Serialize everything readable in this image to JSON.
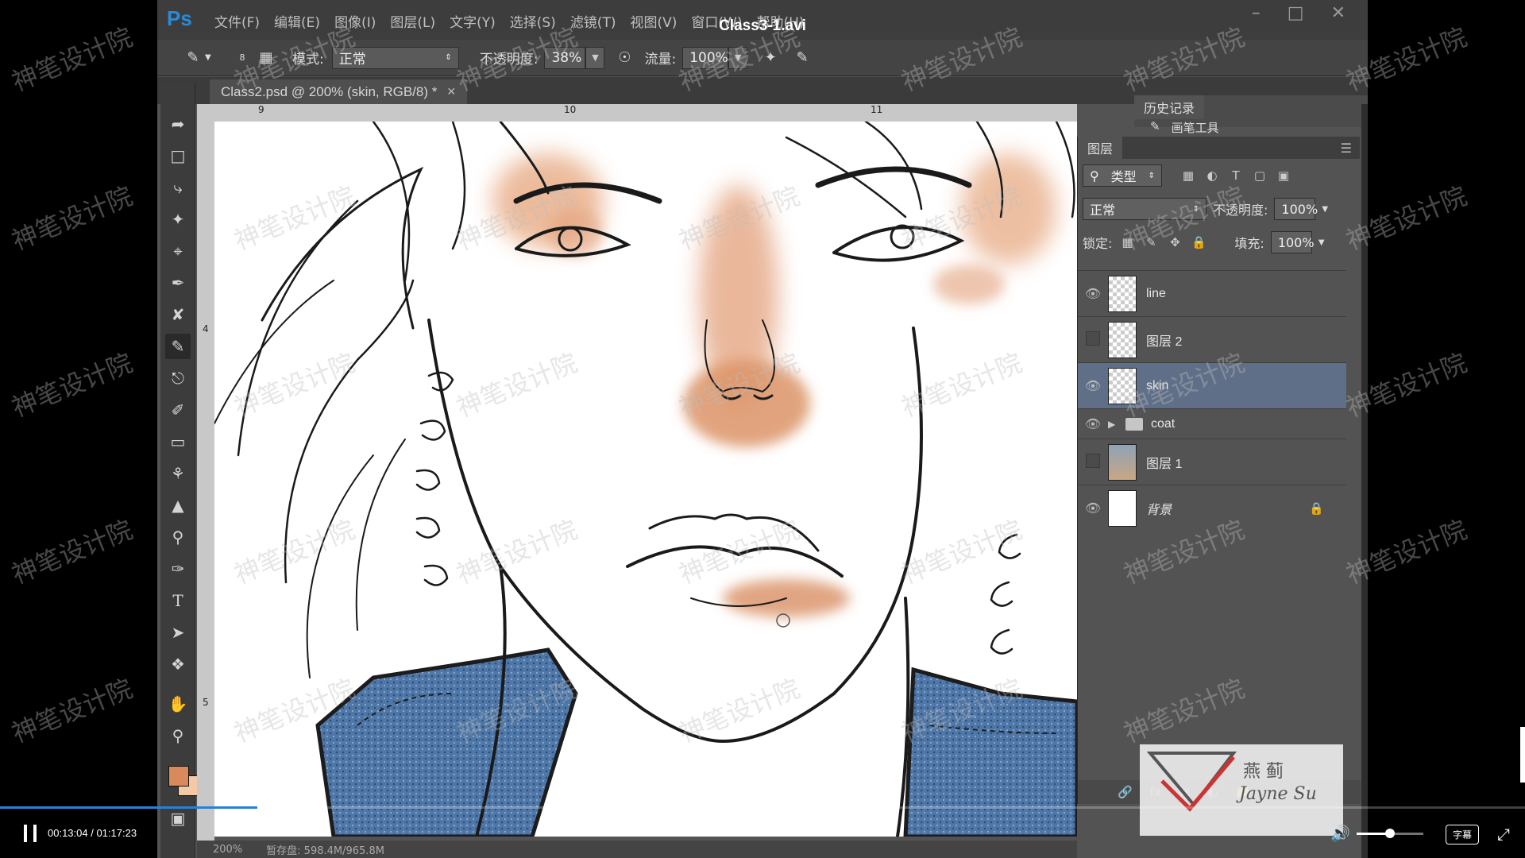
{
  "video": {
    "title": "Class3-1.avi",
    "time_display": "00:13:04 / 01:17:23",
    "progress": 0.169,
    "volume": 0.5,
    "subtitle_label": "字幕"
  },
  "ps": {
    "logo": "Ps",
    "menu": [
      "文件(F)",
      "编辑(E)",
      "图像(I)",
      "图层(L)",
      "文字(Y)",
      "选择(S)",
      "滤镜(T)",
      "视图(V)",
      "窗口(W)",
      "帮助(H)"
    ],
    "options": {
      "brush_size": "8",
      "mode_label": "模式:",
      "mode_value": "正常",
      "opacity_label": "不透明度:",
      "opacity_value": "38%",
      "flow_label": "流量:",
      "flow_value": "100%"
    },
    "doc_tab": "Class2.psd @ 200% (skin, RGB/8) *",
    "ruler_h": [
      "9",
      "10",
      "11"
    ],
    "ruler_v": [
      "4",
      "5"
    ],
    "status": {
      "zoom": "200%",
      "docsize": "暂存盘: 598.4M/965.8M"
    }
  },
  "history_panel": {
    "title": "历史记录",
    "item": "画笔工具"
  },
  "layers_panel": {
    "title": "图层",
    "filter_label": "类型",
    "blend_mode": "正常",
    "opacity_label": "不透明度:",
    "opacity_value": "100%",
    "lock_label": "锁定:",
    "fill_label": "填充:",
    "fill_value": "100%",
    "layers": [
      {
        "name": "line",
        "visible": true,
        "selected": false,
        "kind": "transparent"
      },
      {
        "name": "图层 2",
        "visible": false,
        "selected": false,
        "kind": "transparent"
      },
      {
        "name": "skin",
        "visible": true,
        "selected": true,
        "kind": "transparent"
      },
      {
        "name": "coat",
        "visible": true,
        "selected": false,
        "kind": "group"
      },
      {
        "name": "图层 1",
        "visible": false,
        "selected": false,
        "kind": "photo"
      },
      {
        "name": "背景",
        "visible": true,
        "selected": false,
        "kind": "background",
        "locked": true
      }
    ]
  },
  "watermark": "神笔设计院",
  "brand": {
    "signature": "Jayne Su",
    "glyphs": "燕 蓟"
  },
  "colors": {
    "foreground": "#d88a5c",
    "background": "#f3c9a8",
    "progress": "#2b7fd8",
    "selected_layer": "#5f6f88"
  }
}
